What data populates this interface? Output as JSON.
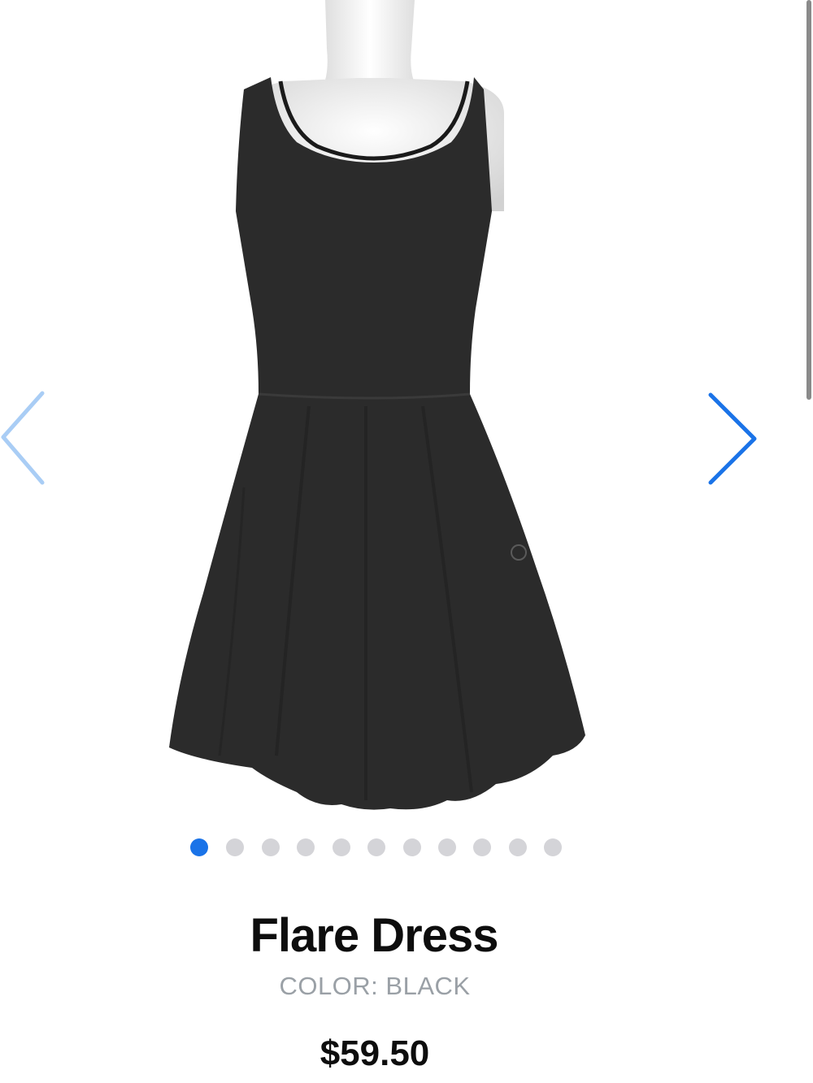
{
  "product": {
    "title": "Flare Dress",
    "color_label": "COLOR: BLACK",
    "price": "$59.50",
    "image_alt": "Flare Dress"
  },
  "carousel": {
    "total_images": 11,
    "active_index": 0,
    "prev_icon": "chevron-left-icon",
    "next_icon": "chevron-right-icon"
  },
  "colors": {
    "accent": "#1a73e8",
    "accent_light": "#a9cdf5",
    "dot_inactive": "#d4d4d8",
    "title": "#0d0d0d",
    "muted": "#9aa0a6",
    "garment": "#2b2b2b"
  }
}
